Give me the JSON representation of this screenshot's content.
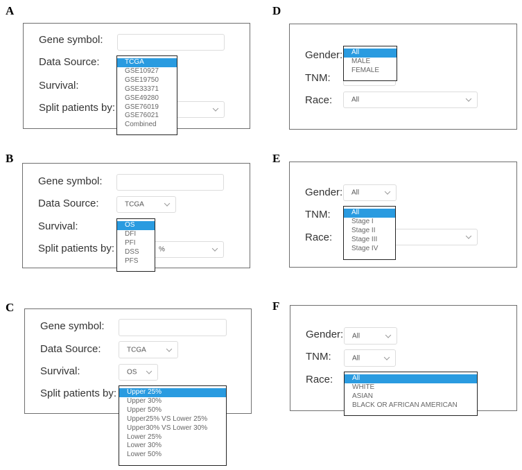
{
  "panels": {
    "A": {
      "letter": "A",
      "labels": {
        "gene": "Gene symbol:",
        "source": "Data Source:",
        "survival": "Survival:",
        "split": "Split patients by:"
      },
      "gene_value": "",
      "source_dropdown": {
        "options": [
          "TCGA",
          "GSE10927",
          "GSE19750",
          "GSE33371",
          "GSE49280",
          "GSE76019",
          "GSE76021",
          "Combined"
        ],
        "selected": "TCGA"
      }
    },
    "B": {
      "letter": "B",
      "labels": {
        "gene": "Gene symbol:",
        "source": "Data Source:",
        "survival": "Survival:",
        "split": "Split patients by:"
      },
      "gene_value": "",
      "source_value": "TCGA",
      "split_value_partial": "%",
      "survival_dropdown": {
        "options": [
          "OS",
          "DFI",
          "PFI",
          "DSS",
          "PFS"
        ],
        "selected": "OS"
      }
    },
    "C": {
      "letter": "C",
      "labels": {
        "gene": "Gene symbol:",
        "source": "Data Source:",
        "survival": "Survival:",
        "split": "Split patients by:"
      },
      "gene_value": "",
      "source_value": "TCGA",
      "survival_value": "OS",
      "split_dropdown": {
        "options": [
          "Upper 25%",
          "Upper 30%",
          "Upper 50%",
          "Upper25% VS Lower 25%",
          "Upper30% VS Lower 30%",
          "Lower 25%",
          "Lower 30%",
          "Lower 50%"
        ],
        "selected": "Upper 25%"
      }
    },
    "D": {
      "letter": "D",
      "labels": {
        "gender": "Gender:",
        "tnm": "TNM:",
        "race": "Race:"
      },
      "race_value": "All",
      "gender_dropdown": {
        "options": [
          "All",
          "MALE",
          "FEMALE"
        ],
        "selected": "All"
      }
    },
    "E": {
      "letter": "E",
      "labels": {
        "gender": "Gender:",
        "tnm": "TNM:",
        "race": "Race:"
      },
      "gender_value": "All",
      "tnm_dropdown": {
        "options": [
          "All",
          "Stage I",
          "Stage II",
          "Stage III",
          "Stage IV"
        ],
        "selected": "All"
      }
    },
    "F": {
      "letter": "F",
      "labels": {
        "gender": "Gender:",
        "tnm": "TNM:",
        "race": "Race:"
      },
      "gender_value": "All",
      "tnm_value": "All",
      "race_dropdown": {
        "options": [
          "All",
          "WHITE",
          "ASIAN",
          "BLACK OR AFRICAN AMERICAN"
        ],
        "selected": "All"
      }
    }
  },
  "colors": {
    "highlight": "#2a9be0",
    "frame": "#6e6e6e",
    "dropdown_border": "#222222"
  }
}
